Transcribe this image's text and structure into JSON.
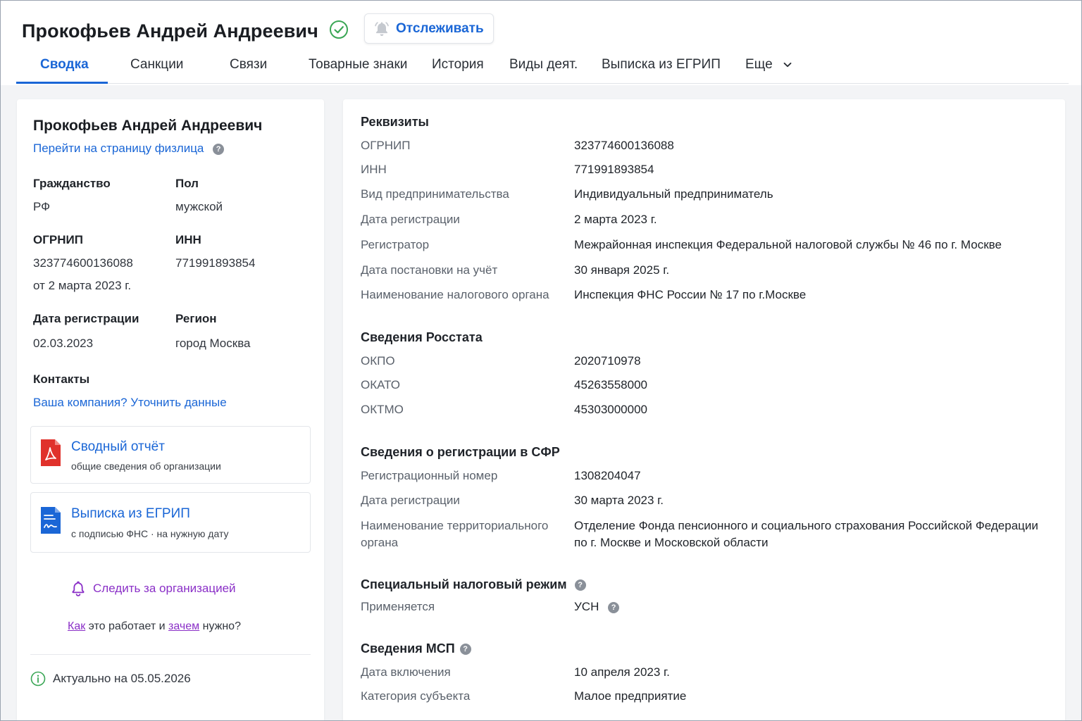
{
  "header": {
    "title": "Прокофьев Андрей Андреевич",
    "track_label": "Отслеживать"
  },
  "tabs": [
    {
      "label": "Сводка"
    },
    {
      "label": "Санкции"
    },
    {
      "label": "Связи"
    },
    {
      "label": "Товарные знаки"
    },
    {
      "label": "История"
    },
    {
      "label": "Виды деят."
    },
    {
      "label": "Выписка из ЕГРИП"
    },
    {
      "label": "Еще"
    }
  ],
  "left": {
    "name": "Прокофьев Андрей Андреевич",
    "person_link": "Перейти на страницу физлица",
    "citizenship_label": "Гражданство",
    "citizenship_value": "РФ",
    "sex_label": "Пол",
    "sex_value": "мужской",
    "ogrnip_label": "ОГРНИП",
    "ogrnip_value": "323774600136088",
    "ogrnip_date": "от 2 марта 2023 г.",
    "inn_label": "ИНН",
    "inn_value": "771991893854",
    "regdate_label": "Дата регистрации",
    "regdate_value": "02.03.2023",
    "region_label": "Регион",
    "region_value": "город Москва",
    "contacts_label": "Контакты",
    "contacts_link": "Ваша компания? Уточнить данные",
    "report_title": "Сводный отчёт",
    "report_sub": "общие сведения об организации",
    "extract_title": "Выписка из ЕГРИП",
    "extract_sub": "с подписью ФНС · на нужную дату",
    "follow_label": "Следить за организацией",
    "howto_how": "Как",
    "howto_mid": " это работает и ",
    "howto_why": "зачем",
    "howto_end": " нужно?",
    "actual": "Актуально на 05.05.2026"
  },
  "right": {
    "requisites": {
      "title": "Реквизиты",
      "rows": [
        {
          "k": "ОГРНИП",
          "v": "323774600136088"
        },
        {
          "k": "ИНН",
          "v": "771991893854"
        },
        {
          "k": "Вид предпринимательства",
          "v": "Индивидуальный предприниматель"
        },
        {
          "k": "Дата регистрации",
          "v": "2 марта 2023 г."
        },
        {
          "k": "Регистратор",
          "v": "Межрайонная инспекция Федеральной налоговой службы № 46 по г. Москве"
        },
        {
          "k": "Дата постановки на учёт",
          "v": "30 января 2025 г."
        },
        {
          "k": "Наименование налогового органа",
          "v": "Инспекция ФНС России № 17 по г.Москве"
        }
      ]
    },
    "rosstat": {
      "title": "Сведения Росстата",
      "rows": [
        {
          "k": "ОКПО",
          "v": "2020710978"
        },
        {
          "k": "ОКАТО",
          "v": "45263558000"
        },
        {
          "k": "ОКТМО",
          "v": "45303000000"
        }
      ]
    },
    "sfr": {
      "title": "Сведения о регистрации в СФР",
      "rows": [
        {
          "k": "Регистрационный номер",
          "v": "1308204047"
        },
        {
          "k": "Дата регистрации",
          "v": "30 марта 2023 г."
        },
        {
          "k": "Наименование территориального органа",
          "v": "Отделение Фонда пенсионного и социального страхования Российской Федерации по г. Москве и Московской области"
        }
      ]
    },
    "tax_regime": {
      "title": "Специальный налоговый режим",
      "rows": [
        {
          "k": "Применяется",
          "v": "УСН"
        }
      ]
    },
    "msp": {
      "title": "Сведения МСП",
      "rows": [
        {
          "k": "Дата включения",
          "v": "10 апреля 2023 г."
        },
        {
          "k": "Категория субъекта",
          "v": "Малое предприятие"
        }
      ]
    }
  },
  "colors": {
    "accent": "#1a66d6",
    "follow": "#8a2fc7",
    "verified": "#3aa655",
    "pdf_red": "#e0312b",
    "doc_blue": "#1a66d6"
  },
  "icons": {
    "verified": "check-circle-icon",
    "track": "bell-icon",
    "more": "chevron-down-icon",
    "help": "question-circle-icon",
    "report": "pdf-file-icon",
    "extract": "signed-document-icon",
    "follow": "bell-outline-icon",
    "actual": "info-circle-icon"
  }
}
